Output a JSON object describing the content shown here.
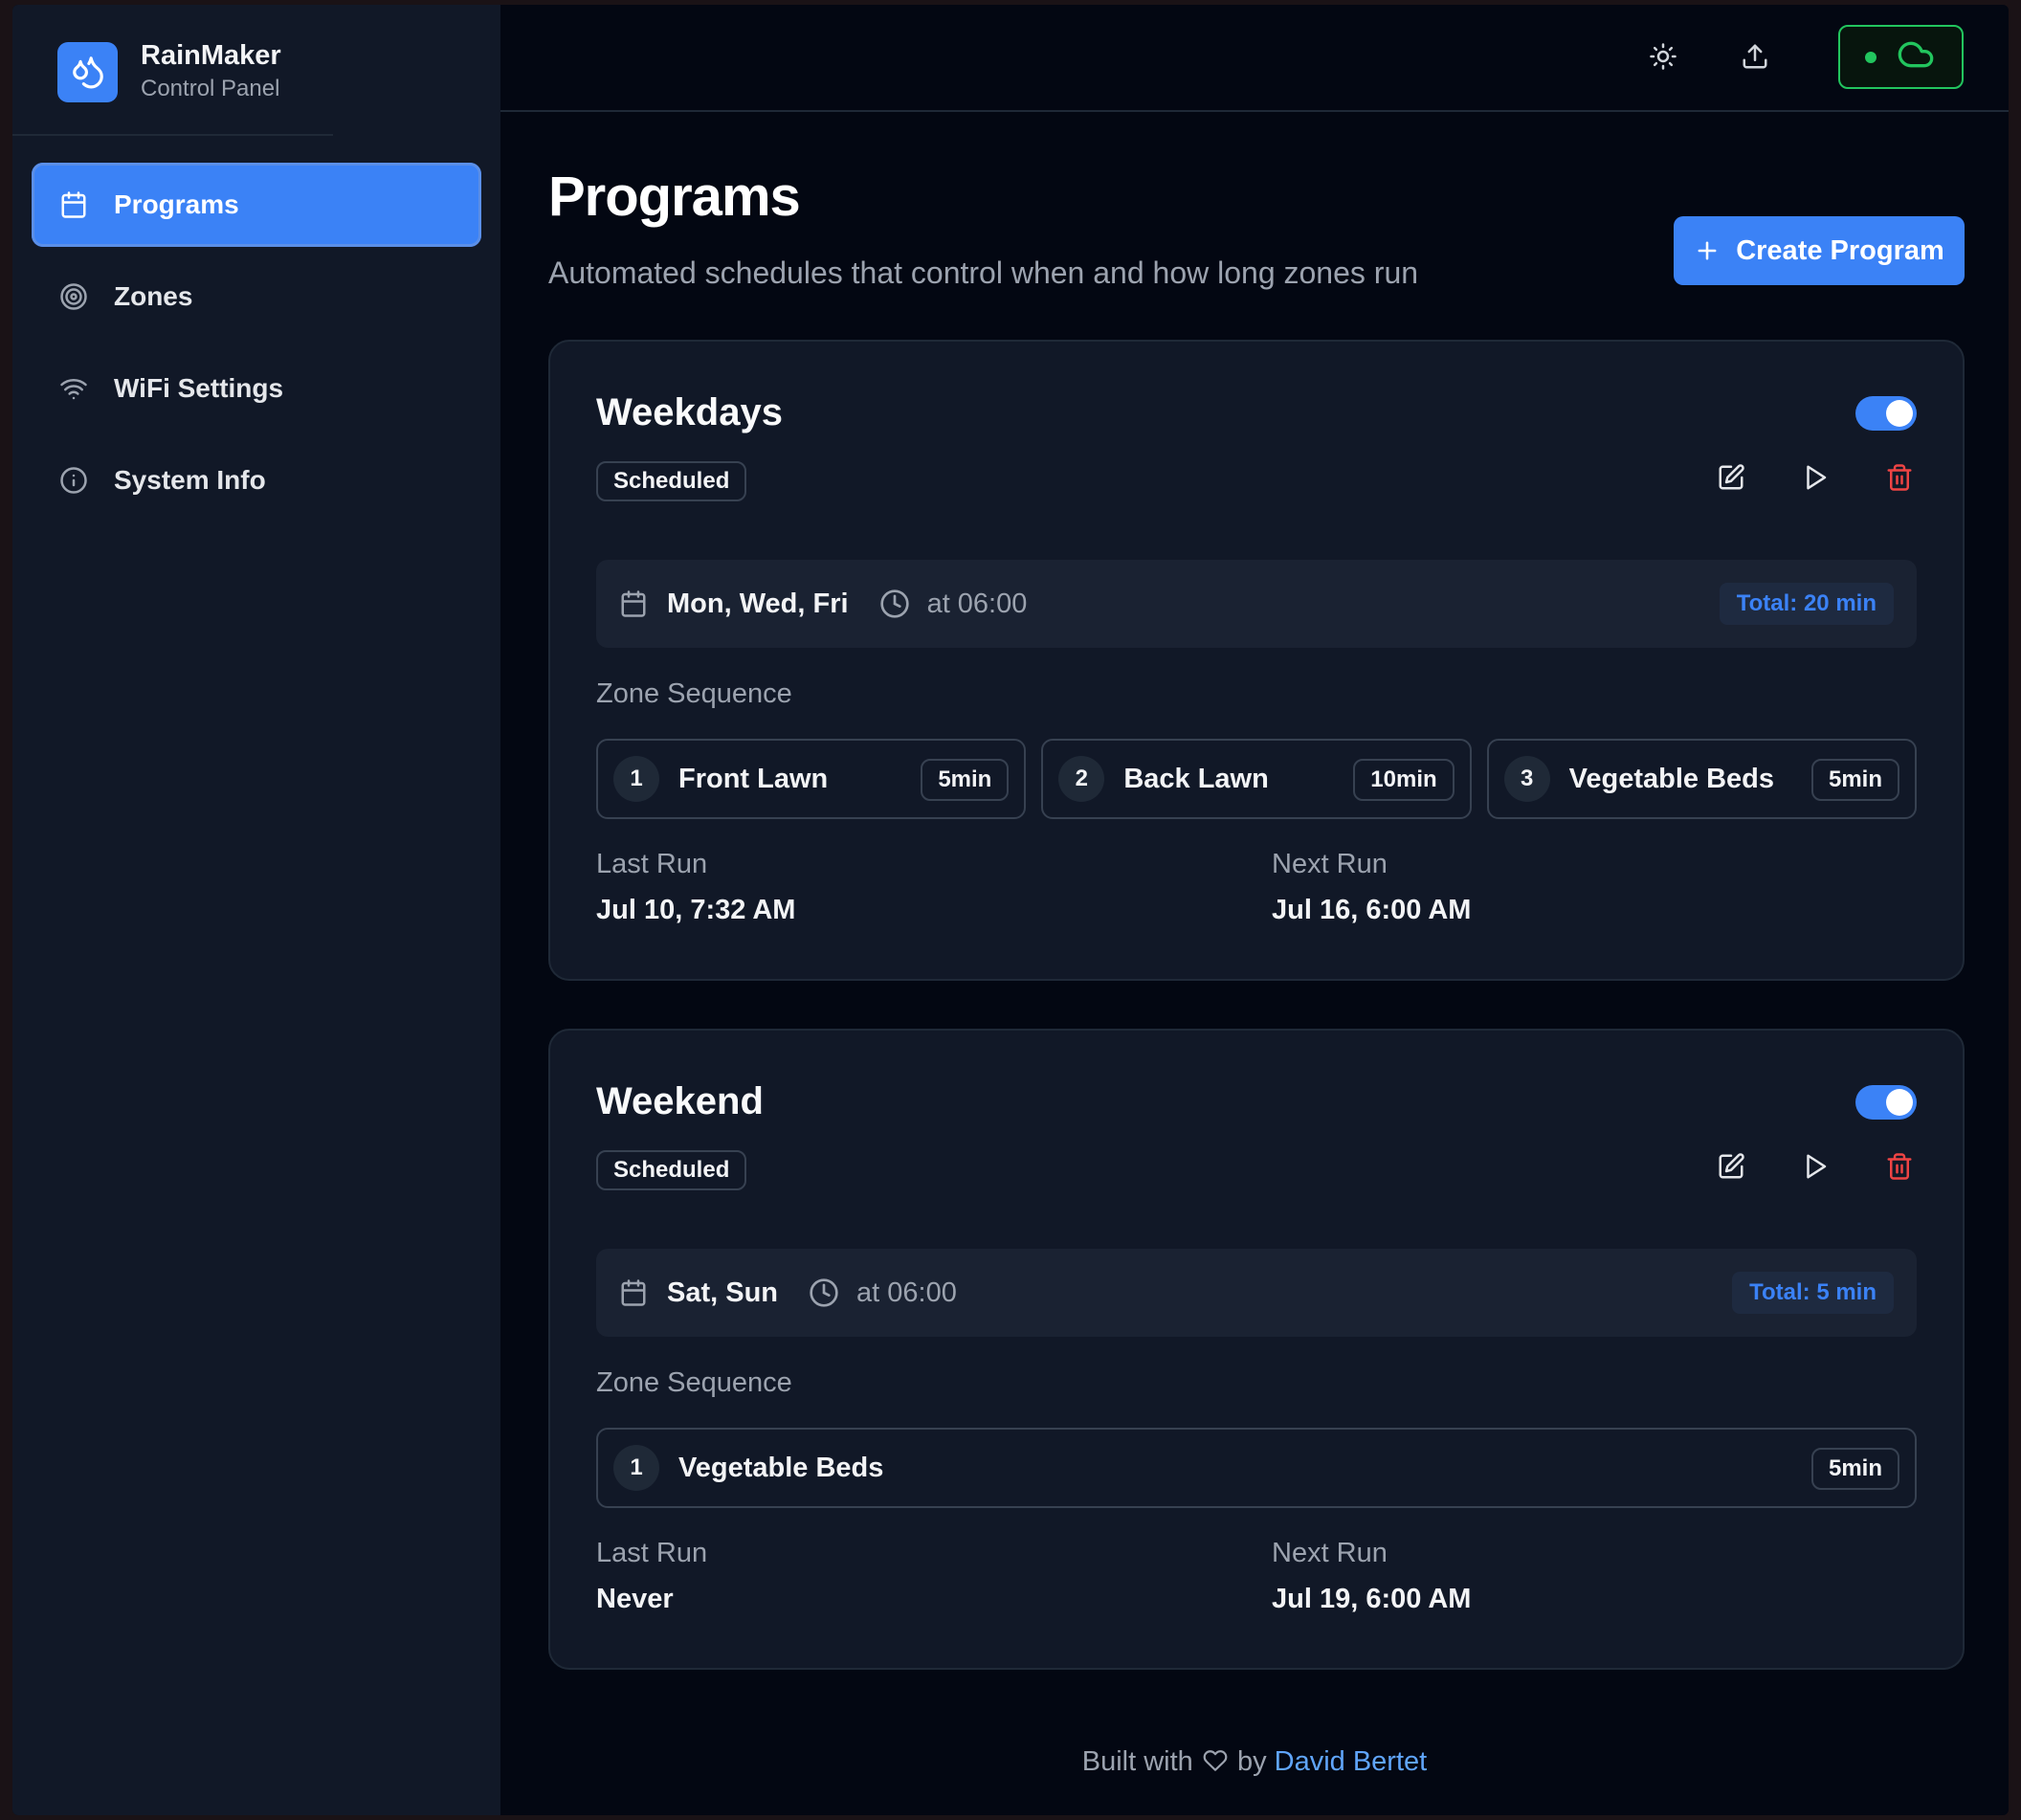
{
  "app": {
    "name": "RainMaker",
    "subtitle": "Control Panel"
  },
  "sidebar": {
    "items": [
      {
        "label": "Programs",
        "icon": "calendar-icon",
        "active": true
      },
      {
        "label": "Zones",
        "icon": "target-icon",
        "active": false
      },
      {
        "label": "WiFi Settings",
        "icon": "wifi-icon",
        "active": false
      },
      {
        "label": "System Info",
        "icon": "info-icon",
        "active": false
      }
    ]
  },
  "topbar": {
    "icons": [
      "sun-icon",
      "upload-icon",
      "cloud-icon"
    ],
    "cloud_status_color": "#22c55e"
  },
  "page": {
    "title": "Programs",
    "subtitle": "Automated schedules that control when and how long zones run",
    "create_label": "Create Program"
  },
  "programs": [
    {
      "name": "Weekdays",
      "enabled": true,
      "status": "Scheduled",
      "days": "Mon, Wed, Fri",
      "time": "at 06:00",
      "total": "Total: 20 min",
      "zone_sequence_label": "Zone Sequence",
      "zones": [
        {
          "order": "1",
          "name": "Front Lawn",
          "duration": "5min"
        },
        {
          "order": "2",
          "name": "Back Lawn",
          "duration": "10min"
        },
        {
          "order": "3",
          "name": "Vegetable Beds",
          "duration": "5min"
        }
      ],
      "last_run_label": "Last Run",
      "last_run": "Jul 10, 7:32 AM",
      "next_run_label": "Next Run",
      "next_run": "Jul 16, 6:00 AM"
    },
    {
      "name": "Weekend",
      "enabled": true,
      "status": "Scheduled",
      "days": "Sat, Sun",
      "time": "at 06:00",
      "total": "Total: 5 min",
      "zone_sequence_label": "Zone Sequence",
      "zones": [
        {
          "order": "1",
          "name": "Vegetable Beds",
          "duration": "5min"
        }
      ],
      "last_run_label": "Last Run",
      "last_run": "Never",
      "next_run_label": "Next Run",
      "next_run": "Jul 19, 6:00 AM"
    }
  ],
  "footer": {
    "prefix": "Built with",
    "by": "by",
    "author": "David Bertet"
  },
  "colors": {
    "accent": "#3b82f6",
    "danger": "#ef4444",
    "success": "#22c55e",
    "background": "#030712",
    "surface": "#111827"
  }
}
